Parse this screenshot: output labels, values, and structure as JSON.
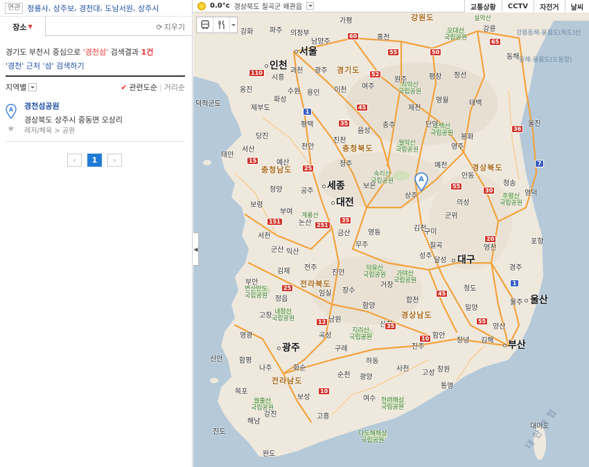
{
  "related": {
    "tag": "연관",
    "links": [
      "청룡사",
      "상주보",
      "경천대",
      "도남서원",
      "상주시"
    ]
  },
  "tabs": {
    "place_label": "장소",
    "clear_label": "지우기"
  },
  "search": {
    "prefix": "경기도 부천시 중심으로 ",
    "keyword": "'경천섬'",
    "middle": " 검색결과 ",
    "count": "1건",
    "nearby": "'경천' 근처 '섬' 검색하기"
  },
  "filter": {
    "region_label": "지역별",
    "sort_relevance": "관련도순",
    "sort_distance": "거리순"
  },
  "results": [
    {
      "name": "경천섬공원",
      "address": "경상북도 상주시 중동면 오상리",
      "category": "레저/체육 > 공원"
    }
  ],
  "pager": {
    "prev": "‹",
    "current": "1",
    "next": "›"
  },
  "weather": {
    "temp": "0.0°c",
    "location": "경상북도 칠곡군 왜관읍"
  },
  "map_buttons": [
    "교통상황",
    "CCTV",
    "자전거",
    "날씨"
  ],
  "map_labels": {
    "big_cities": [
      "서울",
      "인천",
      "세종",
      "대전",
      "대구",
      "울산",
      "부산",
      "광주"
    ],
    "provinces": [
      "강원도",
      "경기도",
      "충청북도",
      "충청남도",
      "경상북도",
      "전라북도",
      "경상남도",
      "전라남도"
    ],
    "cities": [
      "가평",
      "파주",
      "의정부",
      "남양주",
      "강화",
      "홍천",
      "강릉",
      "동해",
      "원주",
      "평창",
      "정선",
      "여주",
      "이천",
      "광주",
      "시흥",
      "과천",
      "수원",
      "용인",
      "옹진",
      "화성",
      "덕적군도",
      "제부도",
      "평택",
      "제천",
      "영월",
      "태백",
      "충주",
      "단양",
      "울진",
      "봉화",
      "음성",
      "진천",
      "영주",
      "당진",
      "서산",
      "천안",
      "태안",
      "예산",
      "청주",
      "예천",
      "안동",
      "청송",
      "영덕",
      "보은",
      "상주",
      "의성",
      "보령",
      "청양",
      "공주",
      "부여",
      "논산",
      "군위",
      "영동",
      "금산",
      "김천",
      "구미",
      "서천",
      "군산",
      "익산",
      "무주",
      "칠곡",
      "영천",
      "포항",
      "성주",
      "달성",
      "김제",
      "전주",
      "진안",
      "경주",
      "부안",
      "정읍",
      "임실",
      "장수",
      "거창",
      "청도",
      "합천",
      "울주",
      "밀양",
      "고창",
      "남원",
      "함양",
      "양산",
      "영광",
      "곡성",
      "산청",
      "창녕",
      "김해",
      "진주",
      "함안",
      "창원",
      "신안",
      "함평",
      "구례",
      "하동",
      "나주",
      "화순",
      "순천",
      "광양",
      "사천",
      "고성",
      "통영",
      "목포",
      "보성",
      "여수",
      "해남",
      "강진",
      "고흥",
      "진도",
      "완도",
      "대마도"
    ],
    "parks": [
      "오대산 국립공원",
      "설악산",
      "치악산 국립공원",
      "소백산 국립공원",
      "월악산 국립공원",
      "속리산 국립공원",
      "주왕산 국립공원",
      "계룡산",
      "덕유산 국립공원",
      "가야산 국립공원",
      "변산반도 국립공원",
      "내장산 국립공원",
      "지리산 국립공원",
      "월출산 국립공원",
      "한려해상 국립공원",
      "다도해해상 국립공원"
    ],
    "seas": [
      "강릉동해-울릉도(독도)선",
      "동해-울릉도(도동항)",
      "대한해협"
    ]
  },
  "colors": {
    "link": "#1f4fa4",
    "accent": "#e33333",
    "land": "#efe8dd",
    "sea": "#b5c9d9",
    "road": "#f2a23c",
    "pager_active": "#1f7cd6"
  }
}
